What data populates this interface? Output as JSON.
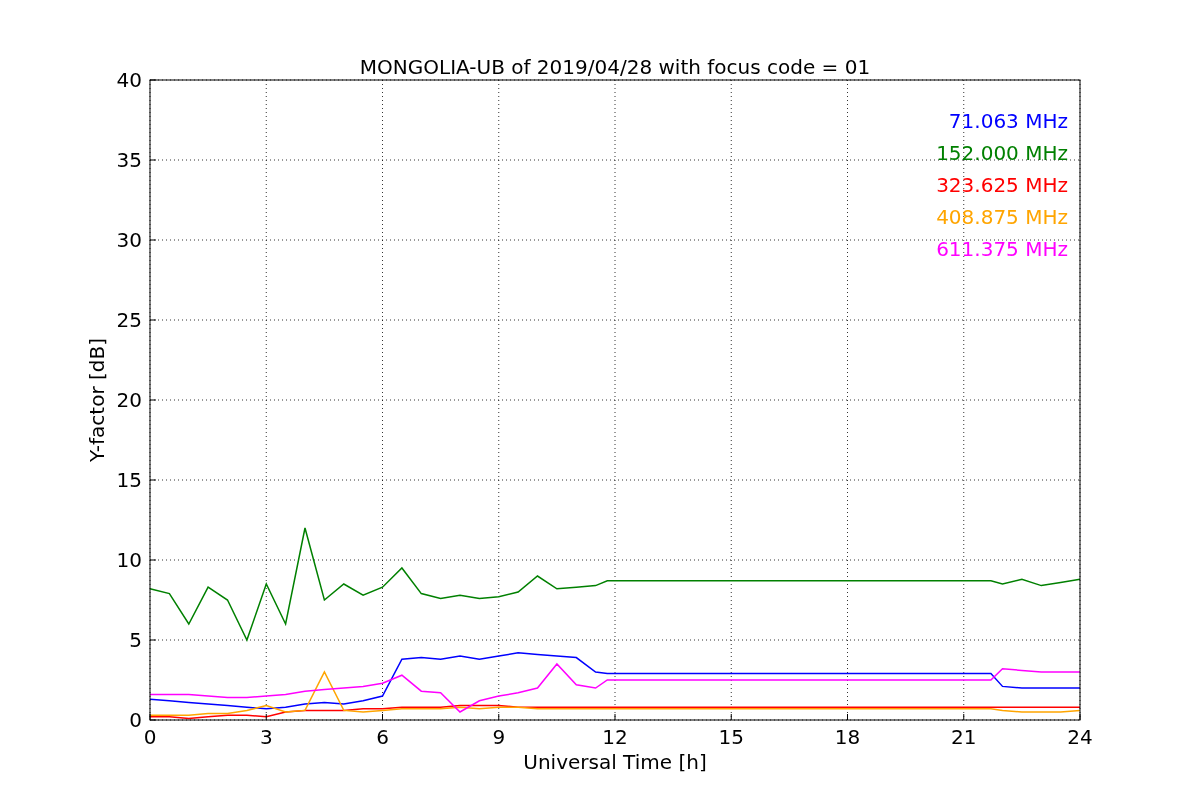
{
  "chart_data": {
    "type": "line",
    "title": "MONGOLIA-UB of 2019/04/28 with focus code = 01",
    "xlabel": "Universal Time [h]",
    "ylabel": "Y-factor [dB]",
    "x": [
      0,
      0.5,
      1,
      1.5,
      2,
      2.5,
      3,
      3.5,
      4,
      4.5,
      5,
      5.5,
      6,
      6.5,
      7,
      7.5,
      8,
      8.5,
      9,
      9.5,
      10,
      10.5,
      11,
      11.5,
      11.8,
      21.7,
      22,
      22.5,
      23,
      23.5,
      24
    ],
    "series": [
      {
        "name": "71.063 MHz",
        "color": "#0000ff",
        "values": [
          1.3,
          1.2,
          1.1,
          1.0,
          0.9,
          0.8,
          0.7,
          0.8,
          1.0,
          1.1,
          1.0,
          1.2,
          1.5,
          3.8,
          3.9,
          3.8,
          4.0,
          3.8,
          4.0,
          4.2,
          4.1,
          4.0,
          3.9,
          3.0,
          2.9,
          2.9,
          2.1,
          2.0,
          2.0,
          2.0,
          2.0
        ]
      },
      {
        "name": "152.000 MHz",
        "color": "#008000",
        "values": [
          8.2,
          7.9,
          6.0,
          8.3,
          7.5,
          5.0,
          8.5,
          6.0,
          12.0,
          7.5,
          8.5,
          7.8,
          8.3,
          9.5,
          7.9,
          7.6,
          7.8,
          7.6,
          7.7,
          8.0,
          9.0,
          8.2,
          8.3,
          8.4,
          8.7,
          8.7,
          8.5,
          8.8,
          8.4,
          8.6,
          8.8
        ]
      },
      {
        "name": "323.625 MHz",
        "color": "#ff0000",
        "values": [
          0.2,
          0.2,
          0.1,
          0.2,
          0.3,
          0.3,
          0.2,
          0.5,
          0.6,
          0.6,
          0.6,
          0.7,
          0.7,
          0.8,
          0.8,
          0.8,
          0.9,
          0.9,
          0.9,
          0.8,
          0.8,
          0.8,
          0.8,
          0.8,
          0.8,
          0.8,
          0.8,
          0.8,
          0.8,
          0.8,
          0.8
        ]
      },
      {
        "name": "408.875 MHz",
        "color": "#ffa500",
        "values": [
          0.3,
          0.3,
          0.3,
          0.4,
          0.4,
          0.6,
          0.9,
          0.5,
          0.6,
          3.0,
          0.6,
          0.5,
          0.6,
          0.7,
          0.7,
          0.7,
          0.8,
          0.7,
          0.8,
          0.8,
          0.7,
          0.7,
          0.7,
          0.7,
          0.7,
          0.7,
          0.6,
          0.5,
          0.5,
          0.5,
          0.6
        ]
      },
      {
        "name": "611.375 MHz",
        "color": "#ff00ff",
        "values": [
          1.6,
          1.6,
          1.6,
          1.5,
          1.4,
          1.4,
          1.5,
          1.6,
          1.8,
          1.9,
          2.0,
          2.1,
          2.3,
          2.8,
          1.8,
          1.7,
          0.5,
          1.2,
          1.5,
          1.7,
          2.0,
          3.5,
          2.2,
          2.0,
          2.5,
          2.5,
          3.2,
          3.1,
          3.0,
          3.0,
          3.0
        ]
      }
    ],
    "grid": true,
    "xlim": [
      0,
      24
    ],
    "ylim": [
      0,
      40
    ],
    "xticks": [
      0,
      3,
      6,
      9,
      12,
      15,
      18,
      21,
      24
    ],
    "yticks": [
      0,
      5,
      10,
      15,
      20,
      25,
      30,
      35,
      40
    ]
  }
}
